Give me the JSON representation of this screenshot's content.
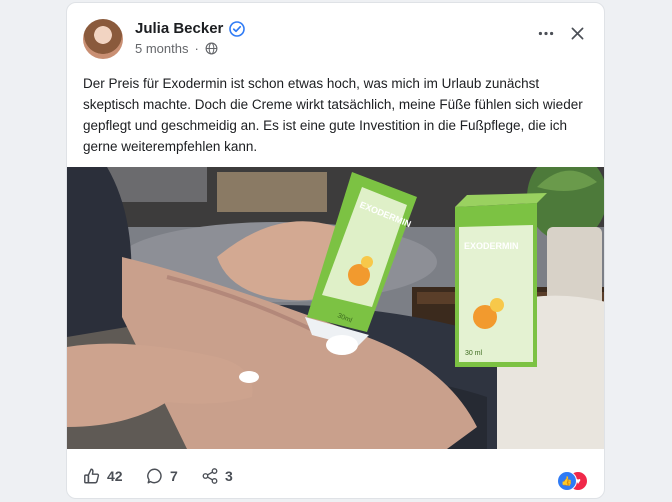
{
  "post": {
    "author": "Julia Becker",
    "time": "5 months",
    "text": "Der Preis für Exodermin ist schon etwas hoch, was mich im Urlaub zunächst skeptisch machte. Doch die Creme wirkt tatsächlich, meine Füße fühlen sich wieder gepflegt und geschmeidig an. Es ist eine gute Investition in die Fußpflege, die ich gerne weiterempfehlen kann.",
    "product_label": "EXODERMIN",
    "tube_volume": "30ml",
    "box_volume": "30 ml"
  },
  "stats": {
    "likes": "42",
    "comments": "7",
    "shares": "3"
  },
  "colors": {
    "accent": "#2f7bf5",
    "love": "#f02849",
    "product_green": "#7cc243"
  },
  "icons": {
    "verified": "verified-badge-icon",
    "privacy": "globe-icon",
    "more": "more-dots-icon",
    "close": "close-icon",
    "like": "thumbs-up-icon",
    "comment": "comment-bubble-icon",
    "share": "share-icon"
  }
}
